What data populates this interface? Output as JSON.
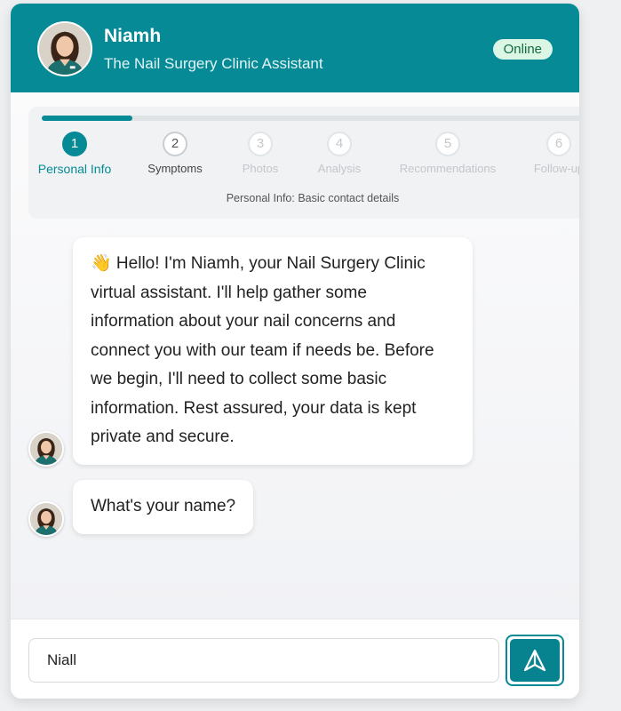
{
  "header": {
    "name": "Niamh",
    "subtitle": "The Nail Surgery Clinic Assistant",
    "status": "Online"
  },
  "progress": {
    "fraction_complete": 0.1667,
    "steps": [
      {
        "number": "1",
        "label": "Personal Info",
        "state": "active"
      },
      {
        "number": "2",
        "label": "Symptoms",
        "state": "next"
      },
      {
        "number": "3",
        "label": "Photos",
        "state": "future"
      },
      {
        "number": "4",
        "label": "Analysis",
        "state": "future"
      },
      {
        "number": "5",
        "label": "Recommendations",
        "state": "future"
      },
      {
        "number": "6",
        "label": "Follow-up",
        "state": "future"
      }
    ],
    "description": "Personal Info: Basic contact details"
  },
  "messages": [
    {
      "sender": "assistant",
      "text": "👋 Hello! I'm Niamh, your Nail Surgery Clinic virtual assistant. I'll help gather some information about your nail concerns and connect you with our team if needs be. Before we begin, I'll need to collect some basic information. Rest assured, your data is kept private and secure."
    },
    {
      "sender": "assistant",
      "text": "What's your name?"
    }
  ],
  "input": {
    "value": "Niall",
    "placeholder": ""
  },
  "icons": {
    "send": "send-arrow-icon",
    "avatar": "assistant-avatar"
  },
  "colors": {
    "brand": "#058a96",
    "status_bg": "#dcf6e6"
  }
}
